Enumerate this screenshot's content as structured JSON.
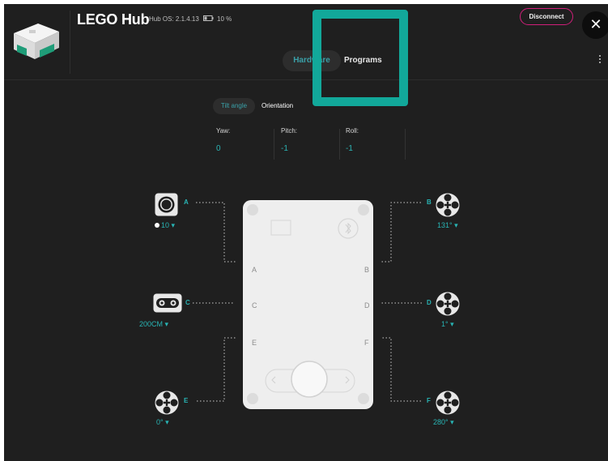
{
  "header": {
    "title": "LEGO Hub",
    "os_version": "Hub OS: 2.1.4.13",
    "battery": "10 %",
    "disconnect_label": "Disconnect",
    "close_icon": "✕"
  },
  "tabs": {
    "hardware": "Hardware",
    "programs": "Programs"
  },
  "sensor_tabs": {
    "tilt": "Tilt angle",
    "orientation": "Orientation"
  },
  "readouts": [
    {
      "label": "Yaw:",
      "value": "0"
    },
    {
      "label": "Pitch:",
      "value": "-1"
    },
    {
      "label": "Roll:",
      "value": "-1"
    }
  ],
  "ports": {
    "A": {
      "label": "A",
      "device": "color-sensor",
      "value": "10"
    },
    "B": {
      "label": "B",
      "device": "motor",
      "value": "131°"
    },
    "C": {
      "label": "C",
      "device": "distance-sensor",
      "value": "200CM"
    },
    "D": {
      "label": "D",
      "device": "motor",
      "value": "1°"
    },
    "E": {
      "label": "E",
      "device": "motor",
      "value": "0°"
    },
    "F": {
      "label": "F",
      "device": "motor",
      "value": "280°"
    }
  },
  "hub_letters": {
    "a": "A",
    "b": "B",
    "c": "C",
    "d": "D",
    "e": "E",
    "f": "F"
  },
  "colors": {
    "accent": "#2bb3b3",
    "highlight": "#12a89a",
    "disconnect": "#d11f7a",
    "background": "#1f1f1f"
  }
}
